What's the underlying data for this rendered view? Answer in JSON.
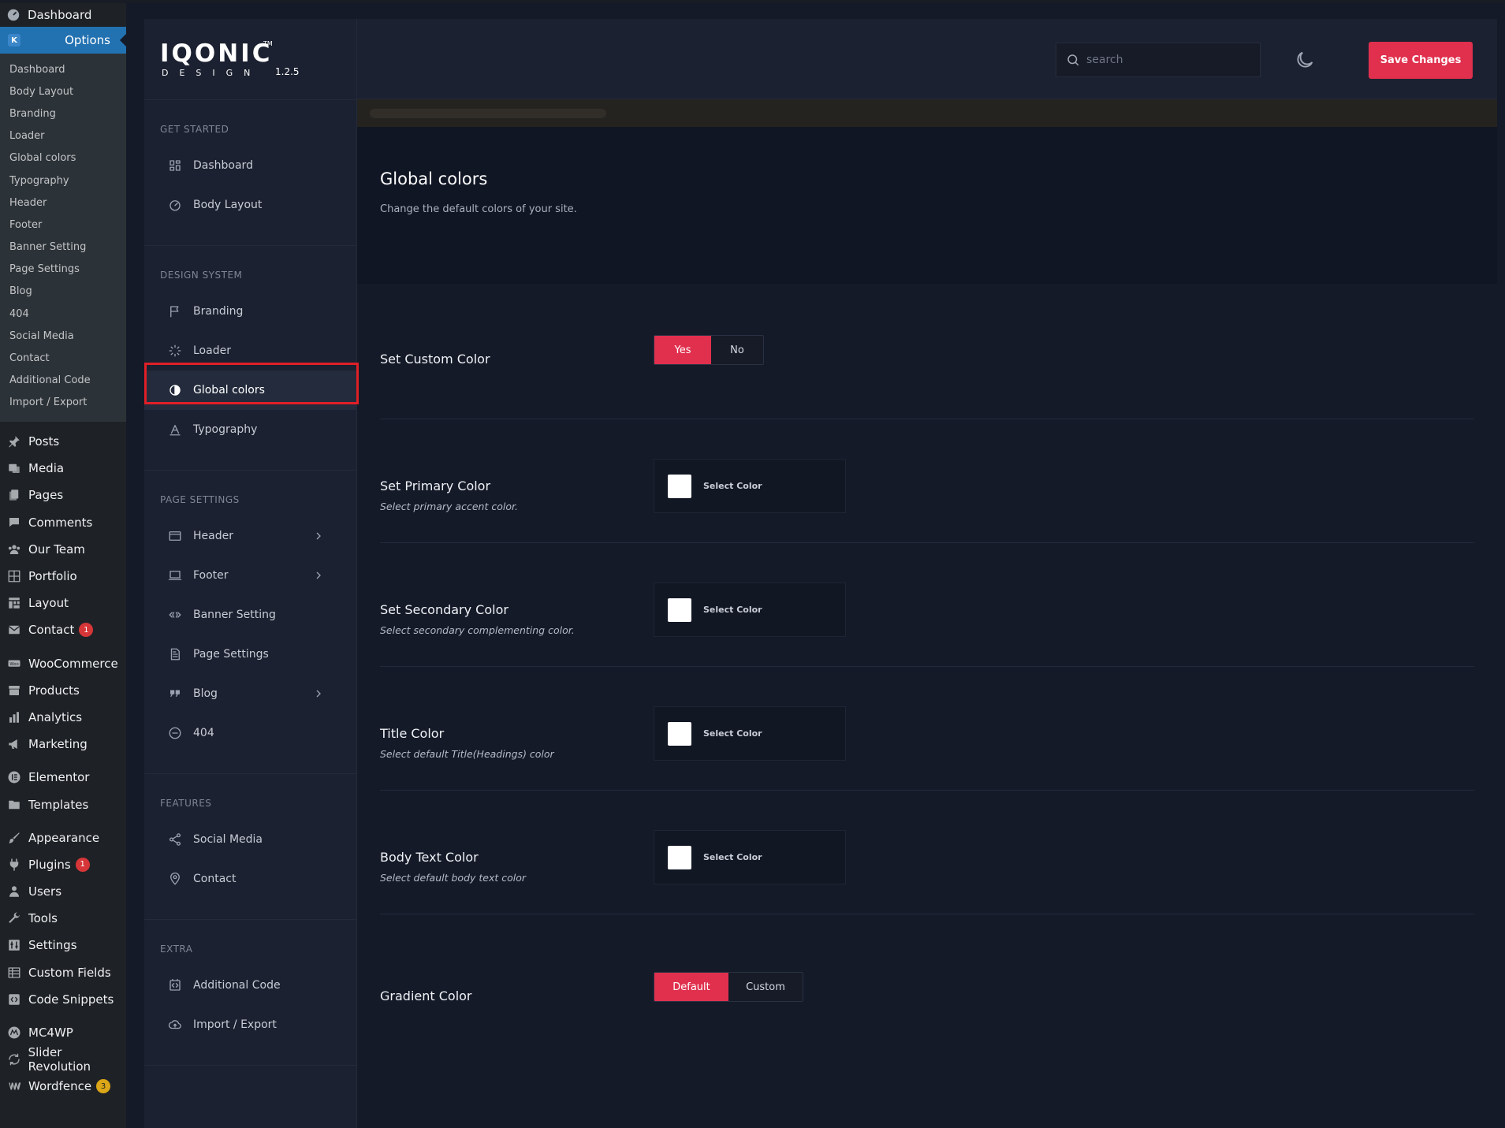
{
  "wp_sidebar": {
    "dashboard": "Dashboard",
    "options": "Options",
    "options_badge": "K",
    "submenu": [
      "Dashboard",
      "Body Layout",
      "Branding",
      "Loader",
      "Global colors",
      "Typography",
      "Header",
      "Footer",
      "Banner Setting",
      "Page Settings",
      "Blog",
      "404",
      "Social Media",
      "Contact",
      "Additional Code",
      "Import / Export"
    ],
    "groups": [
      [
        {
          "label": "Posts",
          "icon": "pin-icon"
        },
        {
          "label": "Media",
          "icon": "media-icon"
        },
        {
          "label": "Pages",
          "icon": "pages-icon"
        },
        {
          "label": "Comments",
          "icon": "comment-icon"
        },
        {
          "label": "Our Team",
          "icon": "team-icon"
        },
        {
          "label": "Portfolio",
          "icon": "portfolio-icon"
        },
        {
          "label": "Layout",
          "icon": "layout-icon"
        },
        {
          "label": "Contact",
          "icon": "mail-icon",
          "badge": "1"
        }
      ],
      [
        {
          "label": "WooCommerce",
          "icon": "woo-icon"
        },
        {
          "label": "Products",
          "icon": "archive-icon"
        },
        {
          "label": "Analytics",
          "icon": "chart-icon"
        },
        {
          "label": "Marketing",
          "icon": "megaphone-icon"
        }
      ],
      [
        {
          "label": "Elementor",
          "icon": "elementor-icon"
        },
        {
          "label": "Templates",
          "icon": "folder-icon"
        }
      ],
      [
        {
          "label": "Appearance",
          "icon": "brush-icon"
        },
        {
          "label": "Plugins",
          "icon": "plug-icon",
          "badge": "1"
        },
        {
          "label": "Users",
          "icon": "user-icon"
        },
        {
          "label": "Tools",
          "icon": "wrench-icon"
        },
        {
          "label": "Settings",
          "icon": "sliders-icon"
        },
        {
          "label": "Custom Fields",
          "icon": "fields-icon"
        },
        {
          "label": "Code Snippets",
          "icon": "code-icon"
        }
      ],
      [
        {
          "label": "MC4WP",
          "icon": "mc4wp-icon"
        },
        {
          "label": "Slider Revolution",
          "icon": "refresh-icon"
        },
        {
          "label": "Wordfence",
          "icon": "wordfence-icon",
          "badge": "3",
          "badge_color": "yellow"
        }
      ]
    ]
  },
  "brand": {
    "wordmark": "IQONIC",
    "tm": "TM",
    "subtitle": "DESIGN",
    "version": "1.2.5"
  },
  "nav": {
    "sections": [
      {
        "title": "GET STARTED",
        "items": [
          {
            "label": "Dashboard",
            "icon": "grid-icon"
          },
          {
            "label": "Body Layout",
            "icon": "gauge-icon"
          }
        ]
      },
      {
        "title": "DESIGN SYSTEM",
        "items": [
          {
            "label": "Branding",
            "icon": "flag-icon"
          },
          {
            "label": "Loader",
            "icon": "loader-icon"
          },
          {
            "label": "Global colors",
            "icon": "contrast-icon",
            "active": true
          },
          {
            "label": "Typography",
            "icon": "typography-icon"
          }
        ]
      },
      {
        "title": "PAGE SETTINGS",
        "items": [
          {
            "label": "Header",
            "icon": "window-icon",
            "chevron": true
          },
          {
            "label": "Footer",
            "icon": "laptop-icon",
            "chevron": true
          },
          {
            "label": "Banner Setting",
            "icon": "code-brackets-icon"
          },
          {
            "label": "Page Settings",
            "icon": "file-icon"
          },
          {
            "label": "Blog",
            "icon": "quote-icon",
            "chevron": true
          },
          {
            "label": "404",
            "icon": "minus-circle-icon"
          }
        ]
      },
      {
        "title": "FEATURES",
        "items": [
          {
            "label": "Social Media",
            "icon": "share-icon"
          },
          {
            "label": "Contact",
            "icon": "location-icon"
          }
        ]
      },
      {
        "title": "EXTRA",
        "items": [
          {
            "label": "Additional Code",
            "icon": "code-box-icon"
          },
          {
            "label": "Import / Export",
            "icon": "cloud-icon"
          }
        ]
      }
    ]
  },
  "topbar": {
    "search_placeholder": "search",
    "save_label": "Save Changes"
  },
  "page": {
    "title": "Global colors",
    "description": "Change the default colors of your site."
  },
  "settings": {
    "custom_color": {
      "label": "Set Custom Color",
      "yes": "Yes",
      "no": "No",
      "selected": "Yes"
    },
    "colors": [
      {
        "label": "Set Primary Color",
        "desc": "Select primary accent color.",
        "button": "Select Color",
        "value": "#ffffff"
      },
      {
        "label": "Set Secondary Color",
        "desc": "Select secondary complementing color.",
        "button": "Select Color",
        "value": "#ffffff"
      },
      {
        "label": "Title Color",
        "desc": "Select default Title(Headings) color",
        "button": "Select Color",
        "value": "#ffffff"
      },
      {
        "label": "Body Text Color",
        "desc": "Select default body text color",
        "button": "Select Color",
        "value": "#ffffff"
      }
    ],
    "gradient": {
      "label": "Gradient Color",
      "default": "Default",
      "custom": "Custom",
      "selected": "Default"
    }
  },
  "colors": {
    "accent": "#e0304e",
    "wp_active": "#2271b1",
    "highlight_border": "#e01f27"
  }
}
